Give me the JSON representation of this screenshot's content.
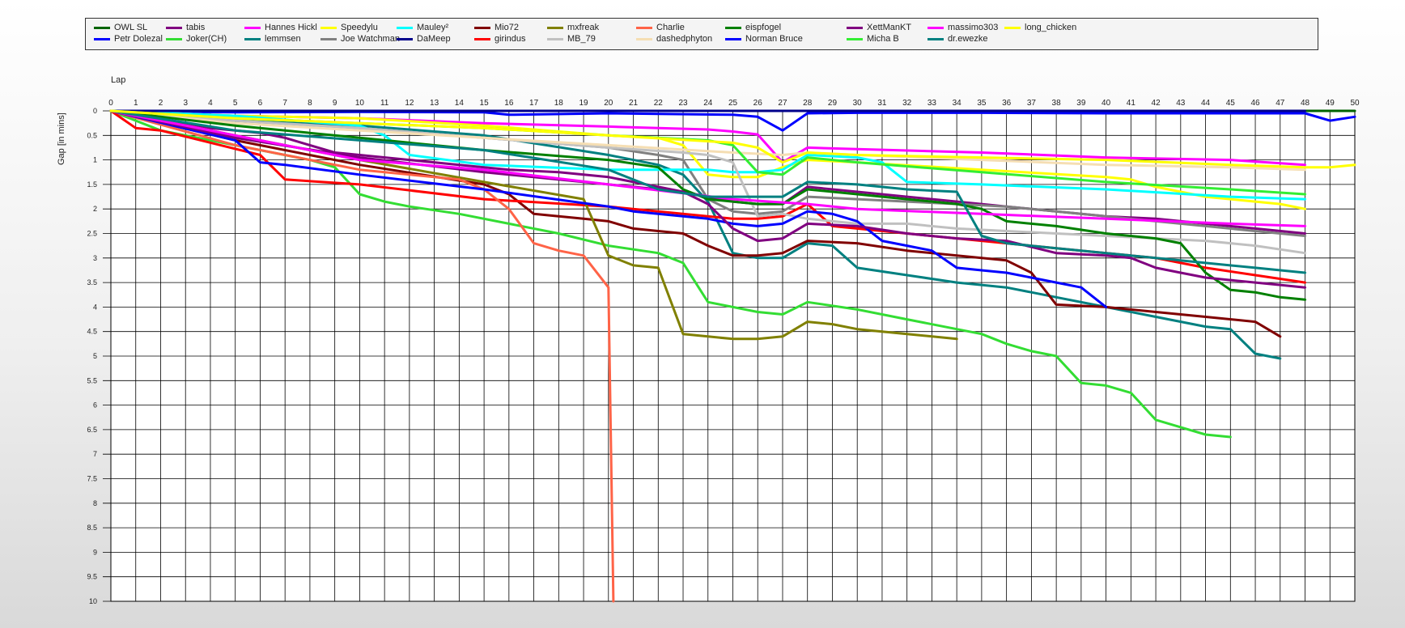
{
  "chart_data": {
    "type": "line",
    "xlabel": "Lap",
    "ylabel": "Gap [in mins]",
    "xlim": [
      0,
      50
    ],
    "ylim": [
      0,
      10
    ],
    "y_inverted": true,
    "grid": true,
    "legend": "top",
    "x_ticks": [
      "0",
      "1",
      "2",
      "3",
      "4",
      "5",
      "6",
      "7",
      "8",
      "9",
      "10",
      "11",
      "12",
      "13",
      "14",
      "15",
      "16",
      "17",
      "18",
      "19",
      "20",
      "21",
      "22",
      "23",
      "24",
      "25",
      "26",
      "27",
      "28",
      "29",
      "30",
      "31",
      "32",
      "33",
      "34",
      "35",
      "36",
      "37",
      "38",
      "39",
      "40",
      "41",
      "42",
      "43",
      "44",
      "45",
      "46",
      "47",
      "48",
      "49",
      "50"
    ],
    "y_ticks": [
      "0",
      "0.5",
      "1",
      "1.5",
      "2",
      "2.5",
      "3",
      "3.5",
      "4",
      "4.5",
      "5",
      "5.5",
      "6",
      "6.5",
      "7",
      "7.5",
      "8",
      "8.5",
      "9",
      "9.5",
      "10"
    ],
    "series": [
      {
        "name": "OWL SL",
        "color": "#006400",
        "x": [
          0,
          5,
          10,
          15,
          20,
          25,
          30,
          35,
          40,
          45,
          50
        ],
        "y": [
          0,
          0,
          0,
          0,
          0,
          0,
          0,
          0,
          0,
          0,
          0
        ]
      },
      {
        "name": "Petr Dolezal",
        "color": "#0000ff",
        "x": [
          0,
          1,
          2,
          5,
          10,
          15,
          16,
          20,
          25,
          26,
          27,
          28,
          30,
          35,
          40,
          45,
          48,
          49,
          50
        ],
        "y": [
          0,
          0.02,
          0.02,
          0.03,
          0.02,
          0.03,
          0.08,
          0.05,
          0.08,
          0.12,
          0.4,
          0.05,
          0.04,
          0.04,
          0.05,
          0.05,
          0.05,
          0.2,
          0.12
        ]
      },
      {
        "name": "tabis",
        "color": "#800080",
        "x": [
          0,
          1,
          2,
          3,
          4,
          5,
          6,
          7,
          8,
          9,
          10,
          12,
          14,
          16,
          18,
          20,
          22,
          24,
          25,
          26,
          27,
          28,
          30,
          32,
          34,
          36,
          38,
          40,
          42,
          44,
          46,
          48
        ],
        "y": [
          0,
          0.12,
          0.2,
          0.25,
          0.35,
          0.4,
          0.45,
          0.55,
          0.7,
          0.85,
          0.9,
          1,
          1.1,
          1.2,
          1.25,
          1.35,
          1.55,
          1.75,
          1.85,
          1.9,
          1.9,
          1.55,
          1.65,
          1.75,
          1.85,
          1.95,
          2.05,
          2.15,
          2.2,
          2.3,
          2.4,
          2.5
        ]
      },
      {
        "name": "Joker(CH)",
        "color": "#33dd33",
        "x": [
          0,
          2,
          4,
          6,
          8,
          9,
          10,
          11,
          12,
          14,
          16,
          18,
          20,
          22,
          23,
          24,
          25,
          26,
          27,
          28,
          30,
          32,
          34,
          35,
          36,
          37,
          38,
          39,
          40,
          41,
          42,
          43,
          44,
          45
        ],
        "y": [
          0,
          0.4,
          0.6,
          0.8,
          1,
          1.15,
          1.7,
          1.85,
          1.95,
          2.1,
          2.3,
          2.5,
          2.75,
          2.9,
          3.1,
          3.9,
          4,
          4.1,
          4.15,
          3.9,
          4.05,
          4.25,
          4.45,
          4.55,
          4.75,
          4.9,
          5,
          5.55,
          5.6,
          5.75,
          6.3,
          6.45,
          6.6,
          6.65
        ]
      },
      {
        "name": "Hannes Hickl",
        "color": "#ff00ff",
        "x": [
          0,
          5,
          10,
          15,
          20,
          24,
          25,
          26,
          27,
          28,
          30,
          35,
          40,
          45,
          48
        ],
        "y": [
          0,
          0.1,
          0.15,
          0.25,
          0.32,
          0.38,
          0.42,
          0.48,
          1.05,
          0.75,
          0.78,
          0.85,
          0.95,
          1.0,
          1.1
        ]
      },
      {
        "name": "lemmsen",
        "color": "#008080",
        "x": [
          0,
          2,
          5,
          10,
          15,
          20,
          22,
          23,
          24,
          25,
          26,
          27,
          28,
          29,
          30,
          32,
          34,
          35,
          36,
          37,
          38,
          40,
          42,
          44,
          45,
          46,
          47
        ],
        "y": [
          0,
          0.1,
          0.2,
          0.3,
          0.5,
          0.9,
          1.1,
          1.3,
          1.85,
          2.9,
          3,
          3,
          2.7,
          2.75,
          3.2,
          3.35,
          3.5,
          3.55,
          3.6,
          3.7,
          3.8,
          4.0,
          4.2,
          4.4,
          4.45,
          4.95,
          5.05
        ]
      },
      {
        "name": "Speedylu",
        "color": "#ffff00",
        "x": [
          0,
          5,
          10,
          15,
          20,
          22,
          23,
          24,
          25,
          26,
          27,
          28,
          30,
          35,
          40,
          41,
          42,
          43,
          44,
          45,
          46,
          47,
          48
        ],
        "y": [
          0,
          0.1,
          0.15,
          0.3,
          0.5,
          0.55,
          0.7,
          1.3,
          1.35,
          1.35,
          1.15,
          1.0,
          1.05,
          1.2,
          1.35,
          1.4,
          1.55,
          1.65,
          1.75,
          1.8,
          1.85,
          1.9,
          2.0
        ]
      },
      {
        "name": "Joe Watchman",
        "color": "#808080",
        "x": [
          0,
          5,
          10,
          15,
          20,
          22,
          23,
          24,
          25,
          26,
          27,
          28,
          30,
          32,
          34,
          36,
          38,
          40,
          42,
          44,
          46,
          48
        ],
        "y": [
          0,
          0.2,
          0.35,
          0.55,
          0.75,
          0.9,
          1.0,
          1.8,
          2.05,
          2.1,
          2.05,
          1.75,
          1.8,
          1.85,
          1.9,
          1.95,
          2.05,
          2.15,
          2.25,
          2.35,
          2.45,
          2.55
        ]
      },
      {
        "name": "Mauley²",
        "color": "#00ffff",
        "x": [
          0,
          5,
          10,
          11,
          12,
          15,
          20,
          24,
          25,
          26,
          27,
          28,
          30,
          31,
          32,
          35,
          40,
          45,
          48
        ],
        "y": [
          0,
          0.1,
          0.3,
          0.5,
          0.9,
          1.1,
          1.2,
          1.2,
          1.25,
          1.25,
          1.2,
          0.9,
          0.95,
          1.05,
          1.45,
          1.5,
          1.6,
          1.75,
          1.8
        ]
      },
      {
        "name": "DaMeep",
        "color": "#00008b",
        "x": [
          0,
          10,
          20,
          30,
          40,
          48
        ],
        "y": [
          0,
          0,
          0,
          0,
          0,
          0
        ]
      },
      {
        "name": "Mio72",
        "color": "#800000",
        "x": [
          0,
          5,
          10,
          15,
          16,
          17,
          18,
          19,
          20,
          21,
          22,
          23,
          24,
          25,
          26,
          27,
          28,
          30,
          32,
          34,
          36,
          37,
          38,
          40,
          42,
          44,
          46,
          47
        ],
        "y": [
          0,
          0.6,
          1.1,
          1.5,
          1.7,
          2.1,
          2.15,
          2.2,
          2.25,
          2.4,
          2.45,
          2.5,
          2.75,
          2.95,
          2.95,
          2.9,
          2.65,
          2.7,
          2.85,
          2.95,
          3.05,
          3.3,
          3.95,
          4.0,
          4.1,
          4.2,
          4.3,
          4.6
        ]
      },
      {
        "name": "girindus",
        "color": "#ff0000",
        "x": [
          0,
          1,
          2,
          6,
          7,
          10,
          15,
          20,
          25,
          26,
          27,
          28,
          29,
          30,
          32,
          34,
          36,
          38,
          40,
          42,
          44,
          46,
          48
        ],
        "y": [
          0,
          0.35,
          0.4,
          0.9,
          1.4,
          1.5,
          1.8,
          1.95,
          2.2,
          2.2,
          2.15,
          1.9,
          2.35,
          2.4,
          2.5,
          2.6,
          2.7,
          2.8,
          2.9,
          3.0,
          3.2,
          3.35,
          3.5
        ]
      },
      {
        "name": "mxfreak",
        "color": "#808000",
        "x": [
          0,
          5,
          10,
          15,
          19,
          20,
          21,
          22,
          23,
          24,
          25,
          26,
          27,
          28,
          29,
          30,
          32,
          34
        ],
        "y": [
          0,
          0.5,
          1.0,
          1.45,
          1.8,
          2.95,
          3.15,
          3.2,
          4.55,
          4.6,
          4.65,
          4.65,
          4.6,
          4.3,
          4.35,
          4.45,
          4.55,
          4.65
        ]
      },
      {
        "name": "MB_79",
        "color": "#c0c0c0",
        "x": [
          0,
          5,
          10,
          15,
          20,
          23,
          24,
          25,
          26,
          27,
          28,
          30,
          32,
          34,
          36,
          38,
          40,
          42,
          44,
          46,
          48
        ],
        "y": [
          0,
          0.2,
          0.35,
          0.55,
          0.75,
          0.85,
          0.9,
          1.05,
          2.15,
          2.1,
          2.2,
          2.3,
          2.3,
          2.4,
          2.45,
          2.5,
          2.55,
          2.6,
          2.65,
          2.75,
          2.9
        ]
      },
      {
        "name": "Charlie",
        "color": "#ff6347",
        "x": [
          0,
          5,
          10,
          14,
          15,
          16,
          17,
          18,
          19,
          20,
          20.2
        ],
        "y": [
          0,
          0.7,
          1.2,
          1.4,
          1.6,
          2.0,
          2.7,
          2.85,
          2.95,
          3.6,
          10
        ]
      },
      {
        "name": "dashedphyton",
        "color": "#f5deb3",
        "x": [
          0,
          5,
          10,
          15,
          20,
          25,
          27,
          28,
          30,
          35,
          40,
          45,
          48
        ],
        "y": [
          0,
          0.25,
          0.4,
          0.55,
          0.7,
          0.85,
          0.9,
          0.85,
          0.9,
          1.0,
          1.1,
          1.15,
          1.2
        ]
      },
      {
        "name": "eispfogel",
        "color": "#008000",
        "x": [
          0,
          5,
          10,
          15,
          20,
          22,
          23,
          24,
          25,
          26,
          27,
          28,
          30,
          32,
          34,
          35,
          36,
          38,
          40,
          42,
          43,
          44,
          45,
          46,
          47,
          48
        ],
        "y": [
          0,
          0.3,
          0.55,
          0.8,
          1.0,
          1.15,
          1.6,
          1.8,
          1.85,
          1.9,
          1.9,
          1.6,
          1.7,
          1.8,
          1.9,
          2.0,
          2.25,
          2.35,
          2.5,
          2.6,
          2.7,
          3.3,
          3.65,
          3.7,
          3.8,
          3.85
        ]
      },
      {
        "name": "Norman Bruce",
        "color": "#0000ff",
        "x": [
          0,
          5,
          6,
          7,
          10,
          15,
          20,
          21,
          22,
          24,
          25,
          26,
          27,
          28,
          29,
          30,
          31,
          32,
          33,
          34,
          35,
          36,
          38,
          39,
          40
        ],
        "y": [
          0,
          0.6,
          1.05,
          1.1,
          1.3,
          1.6,
          1.95,
          2.05,
          2.1,
          2.2,
          2.3,
          2.35,
          2.3,
          2.05,
          2.1,
          2.25,
          2.65,
          2.75,
          2.85,
          3.2,
          3.25,
          3.3,
          3.5,
          3.6,
          4.0
        ]
      },
      {
        "name": "XettManKT",
        "color": "#800080",
        "x": [
          0,
          5,
          10,
          15,
          20,
          23,
          24,
          25,
          26,
          27,
          28,
          30,
          32,
          34,
          36,
          38,
          40,
          41,
          42,
          43,
          44,
          45,
          46,
          47,
          48
        ],
        "y": [
          0,
          0.55,
          0.95,
          1.25,
          1.5,
          1.65,
          1.9,
          2.4,
          2.65,
          2.6,
          2.3,
          2.35,
          2.5,
          2.6,
          2.65,
          2.9,
          2.95,
          3.0,
          3.2,
          3.3,
          3.4,
          3.45,
          3.5,
          3.55,
          3.6
        ]
      },
      {
        "name": "Micha B",
        "color": "#33ee33",
        "x": [
          0,
          5,
          10,
          15,
          20,
          24,
          25,
          26,
          27,
          28,
          30,
          35,
          40,
          45,
          48
        ],
        "y": [
          0,
          0.15,
          0.25,
          0.35,
          0.5,
          0.6,
          0.7,
          1.25,
          1.3,
          0.95,
          1.05,
          1.25,
          1.45,
          1.6,
          1.7
        ]
      },
      {
        "name": "massimo303",
        "color": "#ff00ff",
        "x": [
          0,
          5,
          10,
          15,
          20,
          25,
          28,
          30,
          35,
          40,
          45,
          48
        ],
        "y": [
          0,
          0.5,
          1.0,
          1.2,
          1.5,
          1.8,
          1.9,
          2.0,
          2.1,
          2.2,
          2.3,
          2.35
        ]
      },
      {
        "name": "dr.ewezke",
        "color": "#008080",
        "x": [
          0,
          5,
          10,
          15,
          20,
          22,
          24,
          25,
          26,
          27,
          28,
          30,
          32,
          34,
          35,
          36,
          38,
          40,
          42,
          44,
          46,
          48
        ],
        "y": [
          0,
          0.4,
          0.6,
          0.8,
          1.2,
          1.6,
          1.75,
          1.75,
          1.75,
          1.75,
          1.45,
          1.5,
          1.6,
          1.65,
          2.55,
          2.7,
          2.8,
          2.9,
          3.0,
          3.1,
          3.2,
          3.3
        ]
      },
      {
        "name": "long_chicken",
        "color": "#ffff00",
        "x": [
          0,
          5,
          10,
          15,
          20,
          25,
          26,
          27,
          28,
          30,
          35,
          40,
          45,
          48,
          49,
          50
        ],
        "y": [
          0,
          0.15,
          0.25,
          0.35,
          0.5,
          0.65,
          0.75,
          1.05,
          0.85,
          0.9,
          0.95,
          1.0,
          1.1,
          1.15,
          1.15,
          1.1
        ]
      }
    ]
  }
}
